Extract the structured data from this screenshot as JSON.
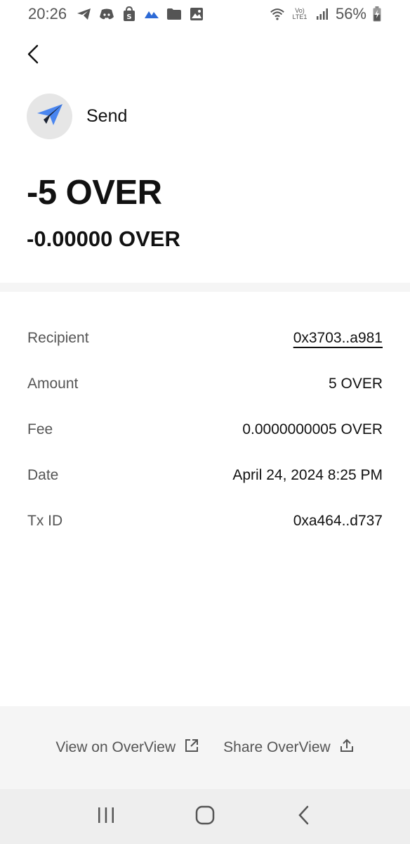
{
  "status_bar": {
    "time": "20:26",
    "battery": "56%",
    "network_label": "Vo) LTE1",
    "left_icons": [
      "telegram-icon",
      "discord-icon",
      "shopping-bag-icon",
      "cloud-icon",
      "folder-icon",
      "gallery-icon"
    ]
  },
  "transaction": {
    "type_label": "Send",
    "amount": "-5 OVER",
    "amount_secondary": "-0.00000 OVER",
    "accent_color": "#4a86f0"
  },
  "details": [
    {
      "label": "Recipient",
      "value": "0x3703..a981"
    },
    {
      "label": "Amount",
      "value": "5 OVER"
    },
    {
      "label": "Fee",
      "value": "0.0000000005 OVER"
    },
    {
      "label": "Date",
      "value": "April 24, 2024 8:25 PM"
    },
    {
      "label": "Tx ID",
      "value": "0xa464..d737"
    }
  ],
  "footer": {
    "view_label": "View on OverView",
    "share_label": "Share OverView"
  }
}
